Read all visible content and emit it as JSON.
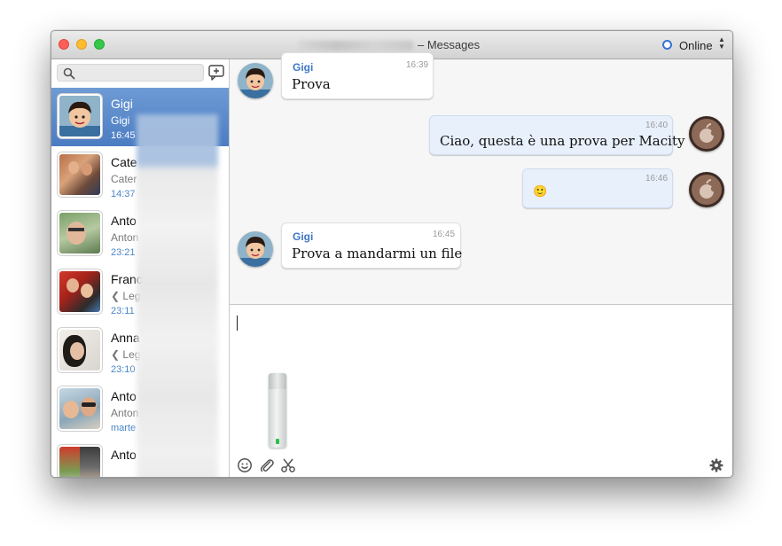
{
  "window": {
    "title": "– Messages",
    "status": {
      "label": "Online",
      "arrows": "▲▼"
    }
  },
  "sidebar": {
    "search": {
      "placeholder": "",
      "value": ""
    },
    "conversations": [
      {
        "name": "Gigi",
        "preview": "Gigi ",
        "time": "16:45",
        "selected": true
      },
      {
        "name": "Cate",
        "preview": "Cater",
        "time": "14:37",
        "selected": false
      },
      {
        "name": "Anto",
        "preview": "Anton",
        "time": "23:21",
        "selected": false
      },
      {
        "name": "Franc",
        "preview": "❮ Leg",
        "time": "23:11",
        "selected": false
      },
      {
        "name": "Anna",
        "preview": "❮ Leg",
        "time": "23:10",
        "selected": false
      },
      {
        "name": "Anto",
        "preview": "Anton",
        "time": "marte",
        "selected": false
      },
      {
        "name": "Anto",
        "preview": "",
        "time": "",
        "selected": false
      }
    ]
  },
  "chat": {
    "messages": [
      {
        "direction": "in",
        "sender": "Gigi",
        "time": "16:39",
        "text": "Prova"
      },
      {
        "direction": "out",
        "sender": "",
        "time": "16:40",
        "text": "Ciao, questa è una prova per Macity"
      },
      {
        "direction": "out",
        "sender": "",
        "time": "16:46",
        "text": "🙂"
      },
      {
        "direction": "in",
        "sender": "Gigi",
        "time": "16:45",
        "text": "Prova a mandarmi un file"
      }
    ]
  },
  "compose": {
    "value": ""
  },
  "colors": {
    "accent": "#4b7cc3",
    "sender": "#3f77c4",
    "outgoing_bubble": "#e8f0fc",
    "timestamp": "#4a86c8",
    "close": "#fc5f57",
    "minimize": "#fdbc2e",
    "zoom": "#34c84a"
  },
  "icons": [
    "search-icon",
    "compose-icon",
    "smiley-icon",
    "paperclip-icon",
    "scissors-icon",
    "gear-icon"
  ]
}
